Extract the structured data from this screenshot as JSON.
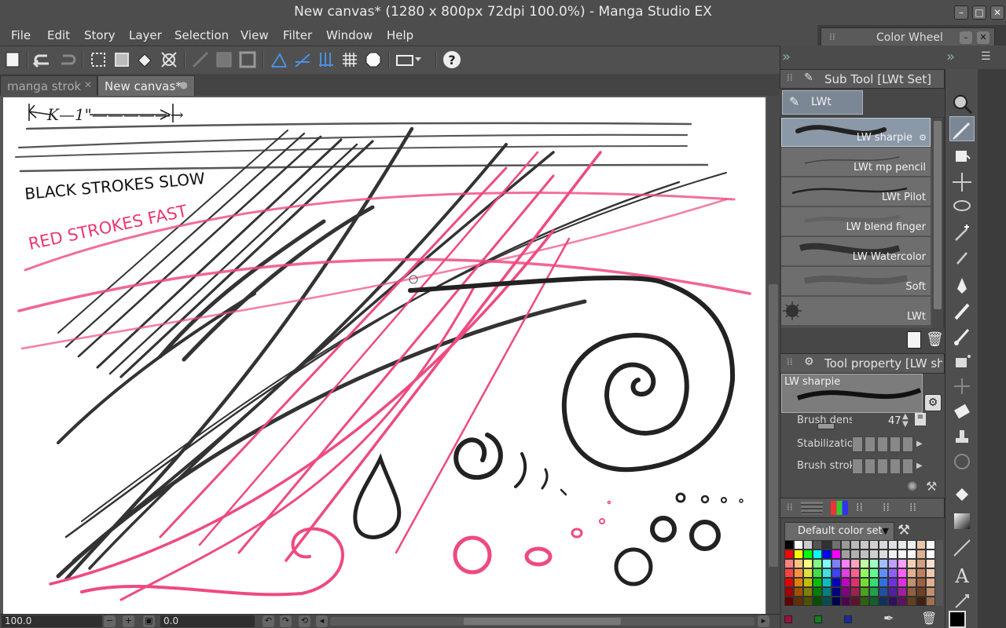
{
  "window": {
    "title": "New canvas* (1280 x 800px 72dpi 100.0%)  - Manga Studio EX"
  },
  "menu": [
    "File",
    "Edit",
    "Story",
    "Layer",
    "Selection",
    "View",
    "Filter",
    "Window",
    "Help"
  ],
  "color_wheel_panel": {
    "title": "Color Wheel"
  },
  "toolbar": {
    "icons": [
      "new-icon",
      "undo-icon",
      "redo-icon",
      "selection-icon",
      "transform-icon",
      "fill-icon",
      "scale-icon",
      "ruler-icon",
      "perspective-icon",
      "grid-icon",
      "snap-icon",
      "help-icon"
    ]
  },
  "tabs": [
    {
      "label": "manga strok",
      "active": false
    },
    {
      "label": "New canvas*",
      "active": true
    }
  ],
  "canvas": {
    "ruler_note": "K—1\"—————→",
    "annotation_black": "BLACK STROKES SLOW",
    "annotation_red": "RED STROKES FAST"
  },
  "statusbar": {
    "zoom": "100.0",
    "rotation": "0.0"
  },
  "subtool_panel": {
    "title": "Sub Tool [LWt Set]",
    "group_tab": "LWt",
    "brushes": [
      {
        "name": "LW sharpie",
        "selected": true
      },
      {
        "name": "LWt mp pencil",
        "selected": false
      },
      {
        "name": "LWt Pilot",
        "selected": false
      },
      {
        "name": "LW blend finger",
        "selected": false
      },
      {
        "name": "LW Watercolor",
        "selected": false
      },
      {
        "name": "Soft",
        "selected": false
      },
      {
        "name": "LWt",
        "selected": false
      }
    ]
  },
  "tool_property": {
    "title": "Tool property [LW sharpie]",
    "preview_label": "LW sharpie",
    "rows": [
      {
        "label": "Brush density",
        "value": "47"
      },
      {
        "label": "Stabilization",
        "value": ""
      },
      {
        "label": "Brush stroke",
        "value": ""
      }
    ]
  },
  "color_set": {
    "selected": "Default color set",
    "swatches": [
      "#000000",
      "#ffffff",
      "#cccccc",
      "#555555",
      "#303030",
      "#707070",
      "#999999",
      "#bbbbbb",
      "#c8c8c8",
      "#d0d0d0",
      "#d8d8d8",
      "#e0e0e0",
      "#e8e8e8",
      "#f0f0f0",
      "#e8c8a8",
      "#f8f8f8",
      "#ff0000",
      "#ffff00",
      "#00ff00",
      "#00ffff",
      "#0000ff",
      "#ff00ff",
      "#a0a0a0",
      "#b0b0b0",
      "#c0c0c0",
      "#cfcfcf",
      "#dddddd",
      "#eeeeee",
      "#f6f6f6",
      "#fafafa",
      "#e0b090",
      "#ffffff",
      "#ff8080",
      "#ffc080",
      "#ffff80",
      "#80ff80",
      "#80ffff",
      "#8080ff",
      "#ff80ff",
      "#ffa0c0",
      "#c0ffa0",
      "#a0ffc0",
      "#a0c0ff",
      "#c0a0ff",
      "#ffa0ff",
      "#f0d0b0",
      "#d0a080",
      "#f8e0d0",
      "#ff4040",
      "#ff9040",
      "#e0e040",
      "#40e040",
      "#40e0e0",
      "#4040ff",
      "#e040e0",
      "#ff6090",
      "#90ff60",
      "#60ff90",
      "#6090ff",
      "#9060ff",
      "#ff60ff",
      "#e0b090",
      "#c08060",
      "#f0c8b0",
      "#e00000",
      "#e08000",
      "#c0c000",
      "#00c000",
      "#00c0c0",
      "#0000c0",
      "#c000c0",
      "#e03070",
      "#70e030",
      "#30e070",
      "#3070e0",
      "#7030e0",
      "#e030e0",
      "#c09070",
      "#a06040",
      "#e0b090",
      "#a00000",
      "#a05000",
      "#808000",
      "#008000",
      "#008080",
      "#000080",
      "#800080",
      "#a02050",
      "#50a020",
      "#20a050",
      "#2050a0",
      "#5020a0",
      "#a020a0",
      "#906040",
      "#704020",
      "#c09070",
      "#600000",
      "#603000",
      "#505000",
      "#005000",
      "#005050",
      "#000050",
      "#500050",
      "#601030",
      "#306010",
      "#106030",
      "#103060",
      "#301060",
      "#601060",
      "#604020",
      "#402010",
      "#a07050"
    ]
  }
}
